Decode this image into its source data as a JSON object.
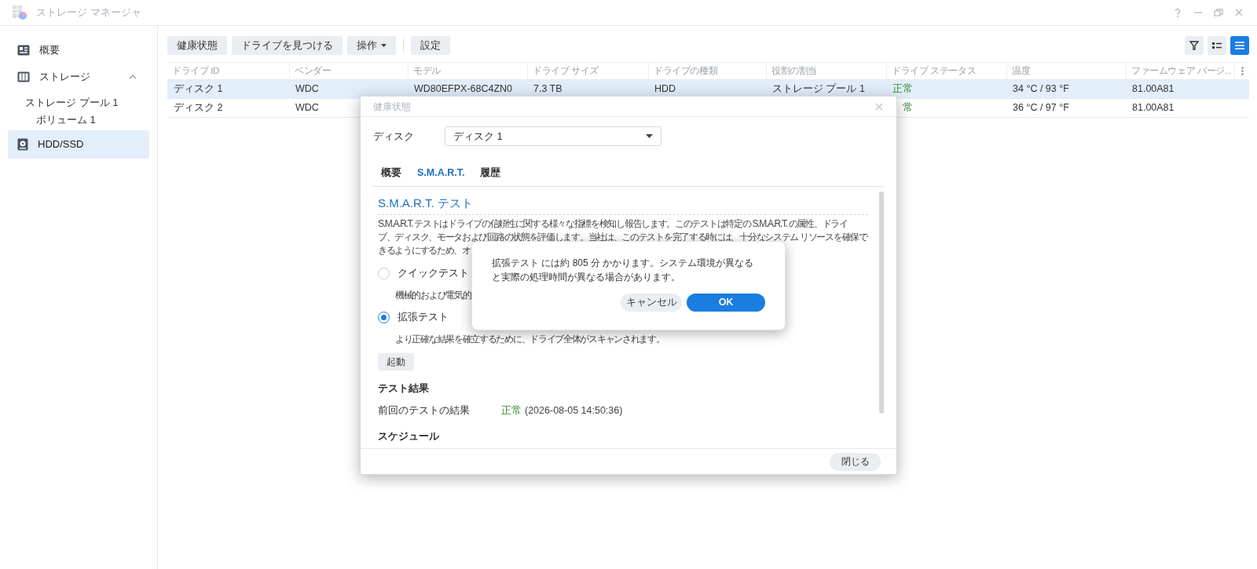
{
  "window": {
    "title": "ストレージ マネージャ"
  },
  "sidebar": {
    "items": [
      {
        "label": "概要",
        "selected": false
      },
      {
        "label": "ストレージ",
        "selected": false,
        "expanded": true,
        "children": [
          {
            "label": "ストレージ プール 1",
            "selected": false,
            "children": [
              {
                "label": "ボリューム 1",
                "selected": false
              }
            ]
          }
        ]
      },
      {
        "label": "HDD/SSD",
        "selected": true
      }
    ]
  },
  "toolbar": {
    "buttons": [
      {
        "label": "健康状態",
        "dropdown": false
      },
      {
        "label": "ドライブを見つける",
        "dropdown": false
      },
      {
        "label": "操作",
        "dropdown": true
      },
      {
        "label": "設定",
        "dropdown": false
      }
    ],
    "view_modes": [
      {
        "selected": false
      },
      {
        "selected": true
      }
    ]
  },
  "table": {
    "columns": [
      "ドライブ ID",
      "ベンダー",
      "モデル",
      "ドライブ サイズ",
      "ドライブの種類",
      "役割の割当",
      "ドライブ ステータス",
      "温度",
      "ファームウェア バージ..."
    ],
    "rows": [
      {
        "selected": true,
        "drive_id": "ディスク 1",
        "vendor": "WDC",
        "model": "WD80EFPX-68C4ZN0",
        "size": "7.3 TB",
        "type": "HDD",
        "role": "ストレージ プール 1",
        "status": "正常",
        "temperature": "34 °C / 93 °F",
        "firmware": "81.00A81"
      },
      {
        "selected": false,
        "drive_id": "ディスク 2",
        "vendor": "WDC",
        "status": "常",
        "temperature": "36 °C / 97 °F",
        "firmware": "81.00A81"
      }
    ]
  },
  "dialog": {
    "title": "健康状態",
    "disk_label": "ディスク",
    "disk_value": "ディスク 1",
    "tabs": [
      {
        "label": "概要",
        "selected": false
      },
      {
        "label": "S.M.A.R.T.",
        "selected": true
      },
      {
        "label": "履歴",
        "selected": false
      }
    ],
    "section_title": "S.M.A.R.T. テスト",
    "description_lines": [
      "S.M.A.R.T. テストはドライブの信頼性に関する様々な指標を検知し報告します。このテストは特定の S.M.A.R.T. の属性、ドライ",
      "ブ、ディスク、モータおよび回路の状態を評価します。当社は、このテストを完了する時には、十分なシステム リソースを確保で",
      "きるようにするため、オ"
    ],
    "options": [
      {
        "label": "クイックテスト",
        "description": "機械的および電気的",
        "selected": false
      },
      {
        "label": "拡張テスト",
        "description": "より正確な結果を確立するために、ドライブ全体がスキャンされます。",
        "selected": true
      }
    ],
    "start_button": "起動",
    "results_title": "テスト結果",
    "last_result": {
      "label": "前回のテストの結果",
      "status": "正常",
      "time": "(2026-08-05 14:50:36)"
    },
    "schedule_title": "スケジュール",
    "close_button": "閉じる"
  },
  "popup": {
    "message": "拡張テスト には約 805 分 かかります。システム環境が異なると実際の処理時間が異なる場合があります。",
    "buttons": [
      {
        "label": "キャンセル",
        "kind": "secondary"
      },
      {
        "label": "OK",
        "kind": "primary"
      }
    ]
  }
}
